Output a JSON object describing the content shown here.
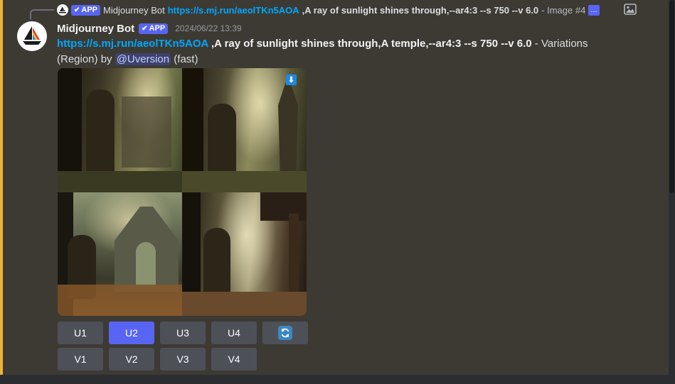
{
  "reply": {
    "author": "Midjourney Bot",
    "badge": "APP",
    "link": "https://s.mj.run/aeolTKn5AOA",
    "prompt": " ,A ray of sunlight shines through,--ar4:3 --s 750 --v 6.0",
    "suffix": " - Image #4",
    "ellipsis": "..."
  },
  "message": {
    "username": "Midjourney Bot",
    "badge": "APP",
    "timestamp": "2024/06/22 13:39",
    "link": "https://s.mj.run/aeolTKn5AOA",
    "prompt": " ,A ray of sunlight shines through,A temple,--ar4:3 --s 750 --v 6.0",
    "suffix": " - Variations (Region) by ",
    "mention": "@Uversion",
    "speed": " (fast)"
  },
  "buttons": {
    "upscale": [
      {
        "label": "U1",
        "active": false
      },
      {
        "label": "U2",
        "active": true
      },
      {
        "label": "U3",
        "active": false
      },
      {
        "label": "U4",
        "active": false
      }
    ],
    "variation": [
      {
        "label": "V1"
      },
      {
        "label": "V2"
      },
      {
        "label": "V3"
      },
      {
        "label": "V4"
      }
    ]
  },
  "icons": {
    "refresh": "refresh-icon",
    "download": "download-icon",
    "image": "image-icon",
    "check": "check-icon"
  },
  "colors": {
    "accent": "#5865f2",
    "link": "#00a8fc",
    "highlight_border": "#f0b232",
    "message_bg": "#3d3a34"
  }
}
